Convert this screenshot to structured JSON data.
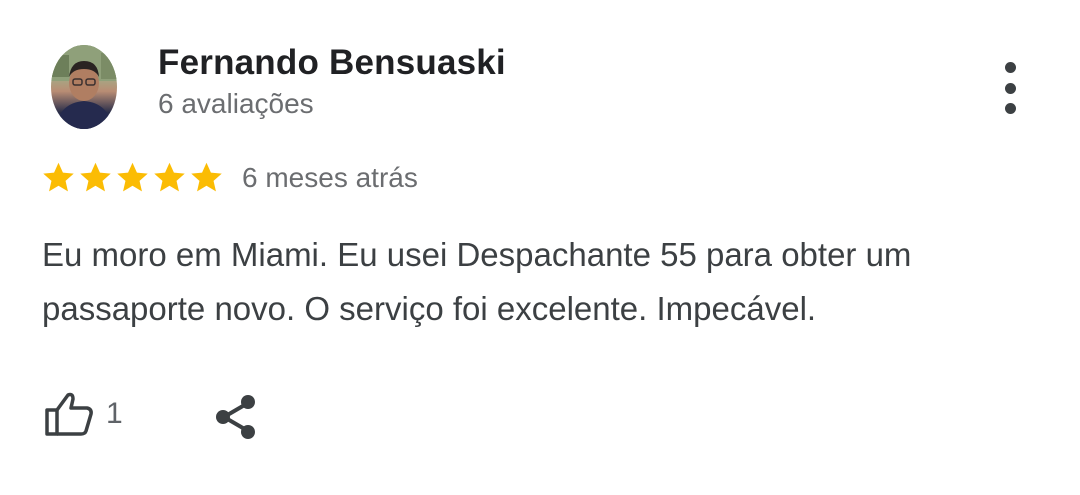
{
  "review": {
    "author_name": "Fernando Bensuaski",
    "review_count": "6 avaliações",
    "rating": 5,
    "rating_max": 5,
    "time_ago": "6 meses atrás",
    "text": "Eu moro em Miami. Eu usei Despachante 55 para obter um passaporte novo. O serviço foi excelente. Impecável.",
    "like_count": "1"
  },
  "icons": {
    "avatar": "avatar-photo",
    "more": "more-vert-icon",
    "star": "star-icon",
    "like": "thumb-up-icon",
    "share": "share-icon"
  },
  "colors": {
    "star": "#FBBC04",
    "name": "#202124",
    "secondary": "#6B6D70",
    "body": "#3C4043",
    "icon": "#3C4043"
  }
}
